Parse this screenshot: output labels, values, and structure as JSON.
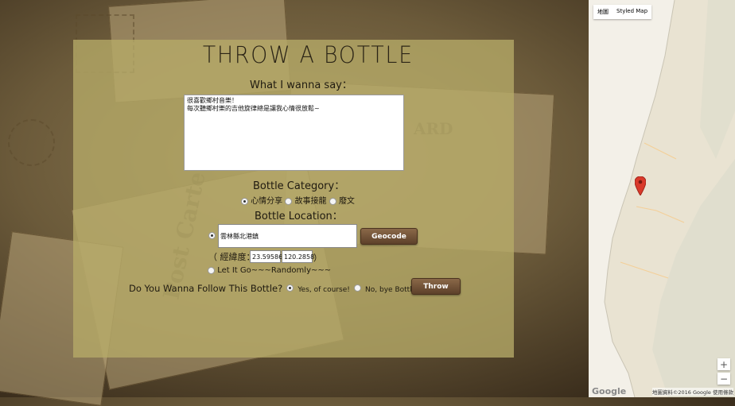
{
  "form": {
    "title": "THROW A BOTTLE",
    "message_label": "What I wanna say：",
    "message_value": "很喜歡鄉村音樂！\n每次聽鄉村樂的吉他旋律總是讓我心情很放鬆~",
    "category_label": "Bottle Category：",
    "categories": [
      "心情分享",
      "故事接龍",
      "廢文"
    ],
    "location_label": "Bottle Location：",
    "address_value": "雲林縣北港鎮",
    "geocode_label": "Geocode",
    "latlng_prefix": "（ 經緯度：",
    "lat_value": "23.59586",
    "lng_value": "120.2858",
    "latlng_suffix": "）",
    "random_label": "Let It Go~~~Randomly~~~",
    "follow_label": "Do You Wanna Follow This Bottle?",
    "follow_yes": "Yes, of course!",
    "follow_no": "No, bye Bottle~",
    "throw_label": "Throw"
  },
  "map": {
    "type_map": "地圖",
    "type_styled": "Styled Map",
    "zoom_in": "+",
    "zoom_out": "−",
    "logo": "Google",
    "attribution": "地圖資料©2016 Google   使用條款"
  },
  "colors": {
    "panel": "#b6aa68",
    "button": "#6e5034",
    "marker": "#d93a2b"
  }
}
